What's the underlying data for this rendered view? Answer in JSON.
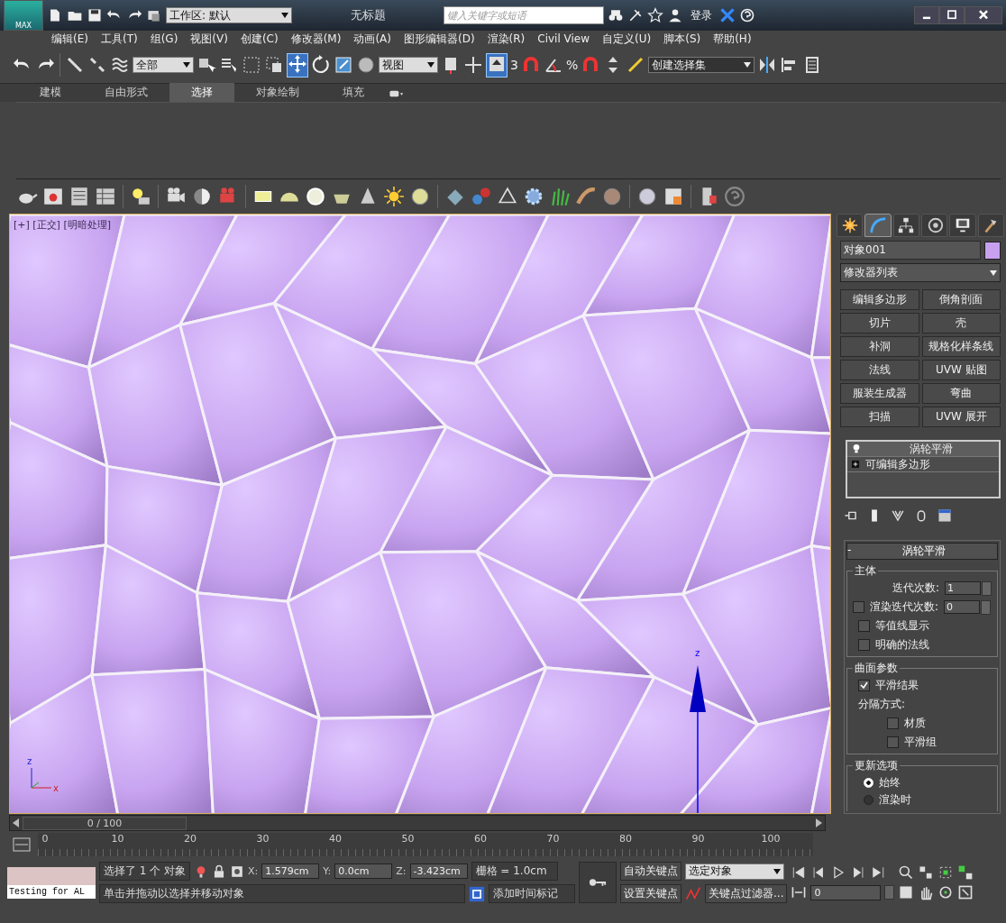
{
  "title_bar": {
    "app_button": "MAX",
    "workspace": "工作区: 默认",
    "title": "无标题",
    "search": {
      "placeholder": "键入关键字或短语"
    },
    "login": "登录"
  },
  "menu": [
    "编辑(E)",
    "工具(T)",
    "组(G)",
    "视图(V)",
    "创建(C)",
    "修改器(M)",
    "动画(A)",
    "图形编辑器(D)",
    "渲染(R)",
    "Civil View",
    "自定义(U)",
    "脚本(S)",
    "帮助(H)"
  ],
  "main_toolbar": {
    "selection_filter": "全部",
    "coord_system": "视图",
    "selection_set": "创建选择集",
    "snap_angle": "3",
    "snap_percent": "%"
  },
  "ribbon_tabs": [
    {
      "label": "建模",
      "selected": false
    },
    {
      "label": "自由形式",
      "selected": false
    },
    {
      "label": "选择",
      "selected": true
    },
    {
      "label": "对象绘制",
      "selected": false
    },
    {
      "label": "填充",
      "selected": false
    }
  ],
  "viewport": {
    "label": "[+] [正交] [明暗处理]",
    "gizmo_axis": "z",
    "tripod_axes": [
      "z",
      "x"
    ]
  },
  "command_panel": {
    "tabs": [
      {
        "kind": "create",
        "selected": false
      },
      {
        "kind": "modify",
        "selected": true
      },
      {
        "kind": "hierarchy",
        "selected": false
      },
      {
        "kind": "motion",
        "selected": false
      },
      {
        "kind": "display",
        "selected": false
      },
      {
        "kind": "utilities",
        "selected": false
      }
    ],
    "object_name": "对象001",
    "modifier_list": "修改器列表",
    "modifier_buttons": [
      "编辑多边形",
      "倒角剖面",
      "切片",
      "壳",
      "补洞",
      "规格化样条线",
      "法线",
      "UVW 贴图",
      "服装生成器",
      "弯曲",
      "扫描",
      "UVW 展开"
    ],
    "stack": [
      {
        "label": "涡轮平滑",
        "kind": "modifier",
        "selected": true
      },
      {
        "label": "可编辑多边形",
        "kind": "base",
        "selected": false
      }
    ],
    "rollout": {
      "title": "涡轮平滑",
      "collapse": "-",
      "main": {
        "title": "主体",
        "iterations_label": "迭代次数:",
        "iterations": "1",
        "render_iterations": {
          "label": "渲染迭代次数:",
          "value": "0",
          "checked": false
        },
        "checks": [
          {
            "label": "等值线显示",
            "checked": false
          },
          {
            "label": "明确的法线",
            "checked": false
          }
        ]
      },
      "surface": {
        "title": "曲面参数",
        "smooth": {
          "label": "平滑结果",
          "checked": true
        },
        "separate_label": "分隔方式:",
        "checks": [
          {
            "label": "材质",
            "checked": false
          },
          {
            "label": "平滑组",
            "checked": false
          }
        ]
      },
      "update": {
        "title": "更新选项",
        "radios": [
          {
            "label": "始终",
            "selected": true
          },
          {
            "label": "渲染时",
            "selected": false
          }
        ]
      }
    }
  },
  "timeline": {
    "position": "0 / 100",
    "level": 0,
    "ticks": [
      "0",
      "10",
      "20",
      "30",
      "40",
      "50",
      "60",
      "70",
      "80",
      "90",
      "100"
    ]
  },
  "status": {
    "maxscript": "Testing for AL",
    "selection": "选择了 1 个 对象",
    "x_label": "X:",
    "x": "1.579cm",
    "y_label": "Y:",
    "y": "0.0cm",
    "z_label": "Z:",
    "z": "-3.423cm",
    "grid": "栅格 = 1.0cm",
    "prompt": "单击并拖动以选择并移动对象",
    "add_time_tag": "添加时间标记",
    "auto_key": "自动关键点",
    "set_key": "设置关键点",
    "key_mode": "选定对象",
    "key_filters": "关键点过滤器...",
    "frame": "0"
  }
}
